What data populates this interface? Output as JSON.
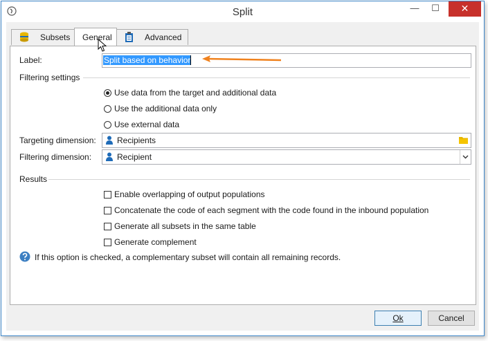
{
  "window": {
    "title": "Split",
    "minimize": "—",
    "maximize": "☐",
    "close": "✕"
  },
  "tabs": [
    {
      "label": "Subsets",
      "icon": "database-icon"
    },
    {
      "label": "General",
      "icon": ""
    },
    {
      "label": "Advanced",
      "icon": "clipboard-icon"
    }
  ],
  "form": {
    "label_caption": "Label:",
    "label_value": "Split based on behavior",
    "filtering_settings_title": "Filtering settings",
    "radios": [
      {
        "label": "Use data from the target and additional data",
        "checked": true
      },
      {
        "label": "Use the additional data only",
        "checked": false
      },
      {
        "label": "Use external data",
        "checked": false
      }
    ],
    "targeting_caption": "Targeting dimension:",
    "targeting_value": "Recipients",
    "filtering_caption": "Filtering dimension:",
    "filtering_value": "Recipient",
    "results_title": "Results",
    "checkboxes": [
      {
        "label": "Enable overlapping of output populations",
        "checked": false
      },
      {
        "label": "Concatenate the code of each segment with the code found in the inbound population",
        "checked": false
      },
      {
        "label": "Generate all subsets in the same table",
        "checked": false
      },
      {
        "label": "Generate complement",
        "checked": false
      }
    ],
    "help_text": "If this option is checked, a complementary subset will contain all remaining records."
  },
  "buttons": {
    "ok_label": "Ok",
    "cancel_label": "Cancel"
  },
  "colors": {
    "accent": "#3c85c8",
    "arrow": "#f0821e",
    "close": "#c7312b",
    "selection": "#3399ff",
    "folder": "#e8b700",
    "person": "#1e6bb8"
  }
}
